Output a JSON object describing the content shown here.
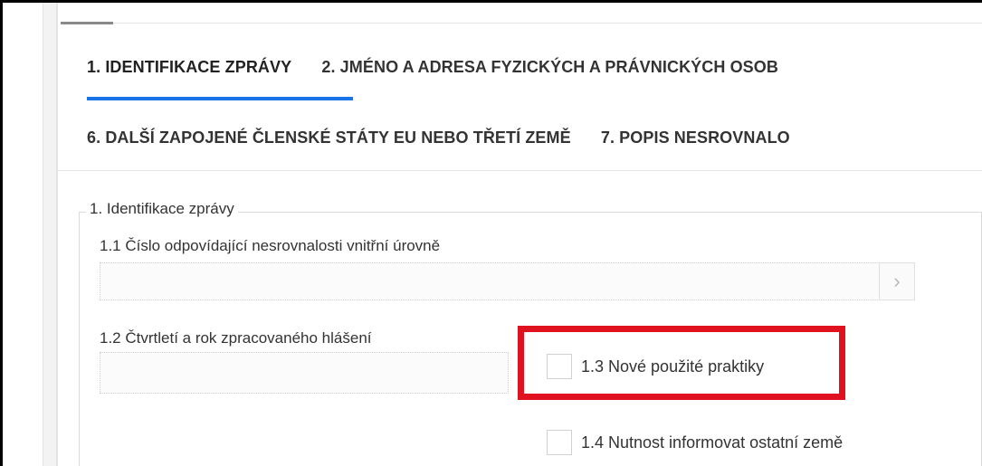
{
  "tabs": {
    "row1": [
      "1. IDENTIFIKACE ZPRÁVY",
      "2. JMÉNO A ADRESA FYZICKÝCH A PRÁVNICKÝCH OSOB"
    ],
    "row2": [
      "6. DALŠÍ ZAPOJENÉ ČLENSKÉ STÁTY EU NEBO TŘETÍ ZEMĚ",
      "7. POPIS NESROVNALO"
    ],
    "active_index": 0
  },
  "section": {
    "legend": "1. Identifikace zprávy"
  },
  "fields": {
    "f1_1_label": "1.1 Číslo odpovídající nesrovnalosti vnitřní úrovně",
    "f1_1_value": "",
    "chevron_icon": "chevron-right-icon",
    "chevron_glyph": "›",
    "f1_2_label": "1.2 Čtvrtletí a rok zpracovaného hlášení",
    "f1_2_value": "",
    "f1_3_label": "1.3 Nové použité praktiky",
    "f1_4_label": "1.4 Nutnost informovat ostatní země"
  },
  "colors": {
    "tab_underline": "#1a73e8",
    "highlight": "#e1121f"
  }
}
